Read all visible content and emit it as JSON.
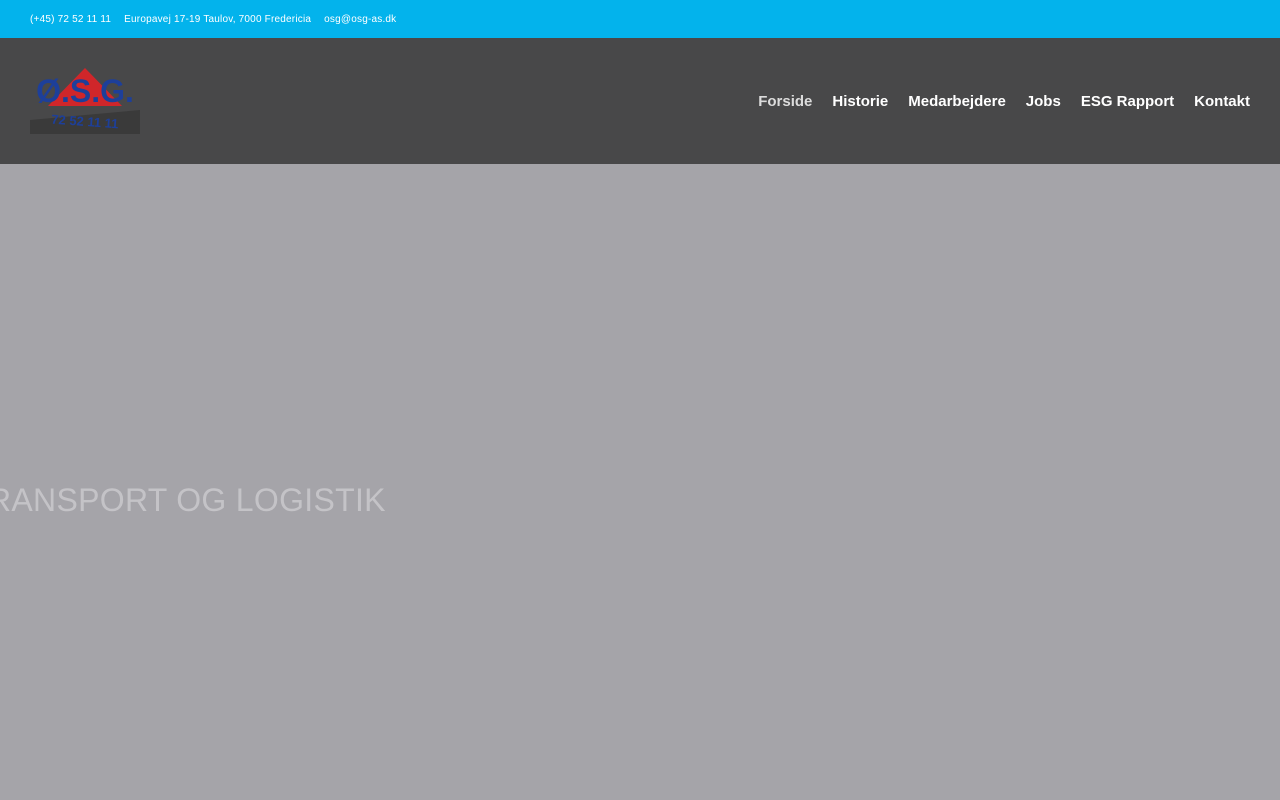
{
  "topbar": {
    "phone": "(+45) 72 52 11 11",
    "address": "Europavej 17-19 Taulov, 7000 Fredericia",
    "email": "osg@osg-as.dk"
  },
  "header": {
    "logo": {
      "icon": "osg-logo-icon",
      "text": "Ø.S.G.",
      "phone": "72 52 11 11"
    },
    "nav": [
      {
        "label": "Forside",
        "active": true
      },
      {
        "label": "Historie"
      },
      {
        "label": "Medarbejdere"
      },
      {
        "label": "Jobs"
      },
      {
        "label": "ESG Rapport"
      },
      {
        "label": "Kontakt"
      }
    ]
  },
  "hero": {
    "text": "RANSPORT OG LOGISTIK"
  },
  "colors": {
    "topbar": "#03b3ec",
    "header": "#484849",
    "hero": "#a5a4a9",
    "logo_blue": "#1d3f9a",
    "logo_red": "#d0262a"
  }
}
